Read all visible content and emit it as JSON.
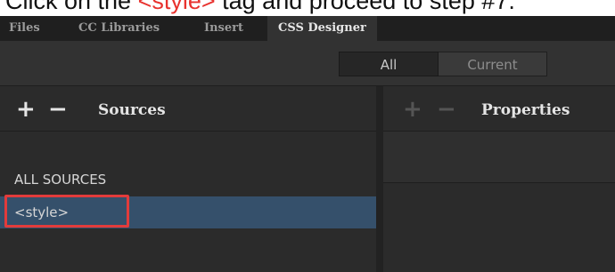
{
  "caption": {
    "text_before": "Click on the ",
    "text_highlight": "<style>",
    "text_after": " tag and proceed to step #7."
  },
  "tabs": [
    {
      "label": "Files",
      "active": false
    },
    {
      "label": "CC Libraries",
      "active": false
    },
    {
      "label": "Insert",
      "active": false
    },
    {
      "label": "CSS Designer",
      "active": true
    }
  ],
  "filter": {
    "all_label": "All",
    "current_label": "Current",
    "selected": "All"
  },
  "sources": {
    "add_glyph": "+",
    "remove_glyph": "−",
    "title": "Sources",
    "items": [
      {
        "label": "ALL SOURCES",
        "selected": false
      },
      {
        "label": "<style>",
        "selected": true
      }
    ]
  },
  "properties": {
    "add_glyph": "+",
    "remove_glyph": "−",
    "title": "Properties"
  },
  "colors": {
    "accent_red": "#e23b3b",
    "selection_blue": "#35506b",
    "panel_bg": "#323232"
  }
}
